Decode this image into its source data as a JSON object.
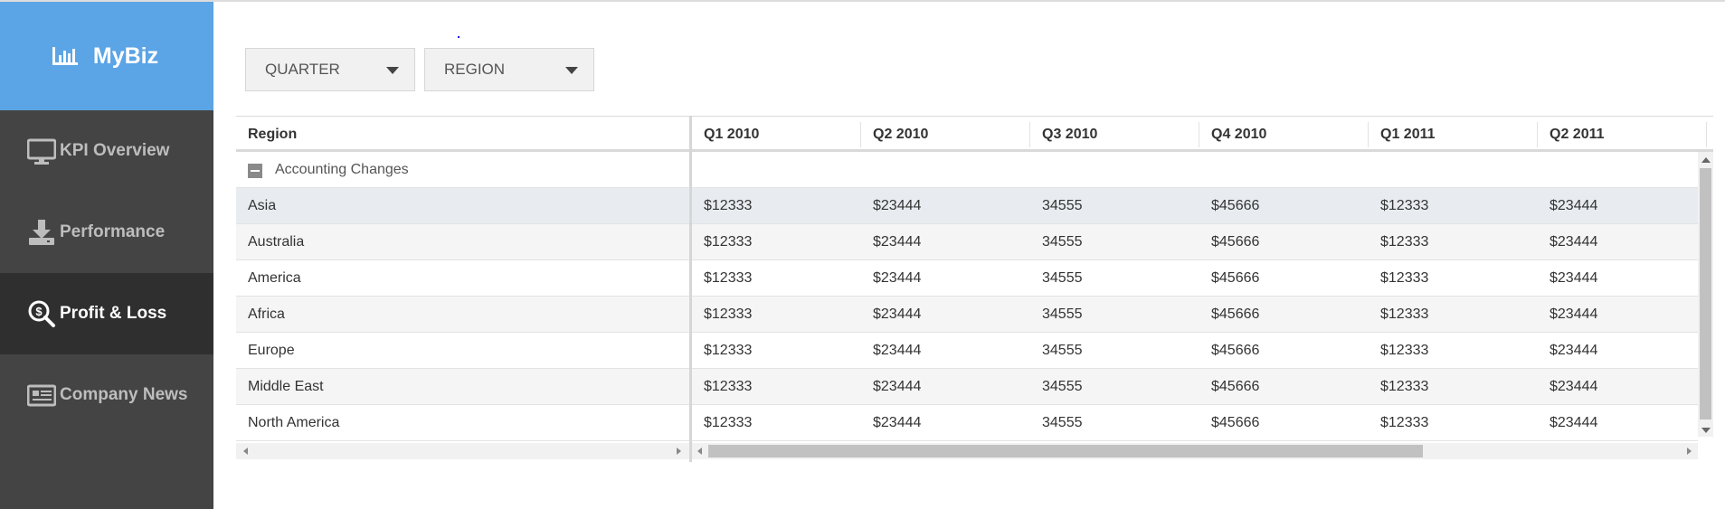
{
  "app": {
    "brand": "MyBiz",
    "colors": {
      "brand_bg": "#5ba4e5",
      "sidebar_bg": "#444444",
      "active_bg": "#2f2f2f"
    }
  },
  "sidebar": {
    "items": [
      {
        "label": "KPI Overview",
        "icon": "monitor-icon"
      },
      {
        "label": "Performance",
        "icon": "download-icon"
      },
      {
        "label": "Profit & Loss",
        "icon": "magnifier-dollar-icon",
        "active": true
      },
      {
        "label": "Company News",
        "icon": "newspaper-icon"
      }
    ]
  },
  "filters": {
    "quarter": "QUARTER",
    "region": "REGION"
  },
  "grid": {
    "columns": [
      "Region",
      "Q1 2010",
      "Q2 2010",
      "Q3 2010",
      "Q4 2010",
      "Q1 2011",
      "Q2 2011"
    ],
    "group": "Accounting Changes",
    "rows": [
      {
        "region": "Asia",
        "values": [
          "$12333",
          "$23444",
          "34555",
          "$45666",
          "$12333",
          "$23444"
        ]
      },
      {
        "region": "Australia",
        "values": [
          "$12333",
          "$23444",
          "34555",
          "$45666",
          "$12333",
          "$23444"
        ]
      },
      {
        "region": "America",
        "values": [
          "$12333",
          "$23444",
          "34555",
          "$45666",
          "$12333",
          "$23444"
        ]
      },
      {
        "region": "Africa",
        "values": [
          "$12333",
          "$23444",
          "34555",
          "$45666",
          "$12333",
          "$23444"
        ]
      },
      {
        "region": "Europe",
        "values": [
          "$12333",
          "$23444",
          "34555",
          "$45666",
          "$12333",
          "$23444"
        ]
      },
      {
        "region": "Middle East",
        "values": [
          "$12333",
          "$23444",
          "34555",
          "$45666",
          "$12333",
          "$23444"
        ]
      },
      {
        "region": "North America",
        "values": [
          "$12333",
          "$23444",
          "34555",
          "$45666",
          "$12333",
          "$23444"
        ]
      }
    ]
  }
}
